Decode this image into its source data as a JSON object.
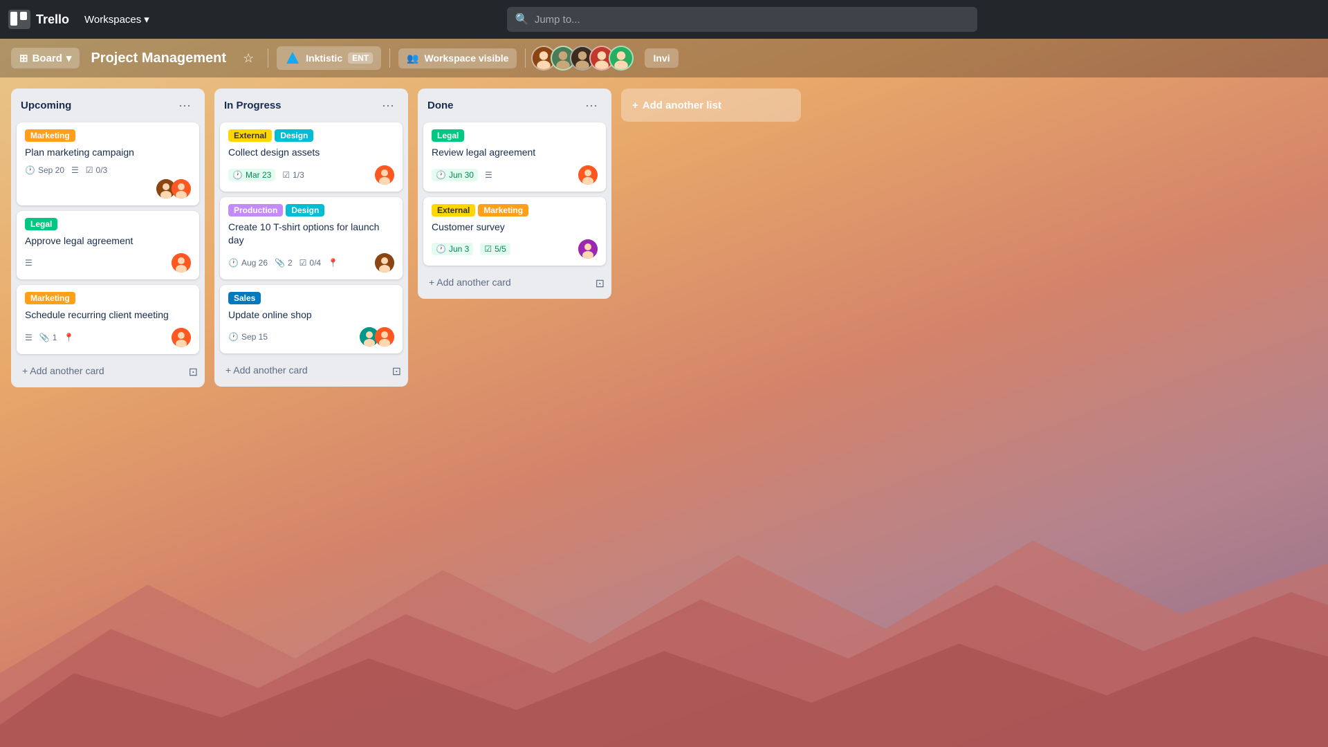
{
  "topNav": {
    "brand": "Trello",
    "workspacesLabel": "Workspaces",
    "searchPlaceholder": "Jump to..."
  },
  "boardHeader": {
    "boardLabel": "Board",
    "title": "Project Management",
    "inktisticLabel": "Inktistic",
    "entLabel": "ENT",
    "workspaceVisibleLabel": "Workspace visible",
    "inviteLabel": "Invi"
  },
  "lists": [
    {
      "id": "upcoming",
      "title": "Upcoming",
      "cards": [
        {
          "id": "c1",
          "labels": [
            {
              "text": "Marketing",
              "cls": "label-marketing"
            }
          ],
          "title": "Plan marketing campaign",
          "date": "Sep 20",
          "hasDesc": true,
          "checklist": "0/3",
          "avatars": [
            "av-brown",
            "av-orange"
          ]
        },
        {
          "id": "c2",
          "labels": [
            {
              "text": "Legal",
              "cls": "label-legal"
            }
          ],
          "title": "Approve legal agreement",
          "hasDesc": true,
          "avatars": [
            "av-orange"
          ]
        },
        {
          "id": "c3",
          "labels": [
            {
              "text": "Marketing",
              "cls": "label-marketing"
            }
          ],
          "title": "Schedule recurring client meeting",
          "hasDesc": true,
          "attachments": "1",
          "hasLocation": true,
          "avatars": [
            "av-orange"
          ]
        }
      ],
      "addLabel": "+ Add another card"
    },
    {
      "id": "inprogress",
      "title": "In Progress",
      "cards": [
        {
          "id": "c4",
          "labels": [
            {
              "text": "External",
              "cls": "label-external"
            },
            {
              "text": "Design",
              "cls": "label-design"
            }
          ],
          "title": "Collect design assets",
          "date": "Mar 23",
          "dateGreen": true,
          "checklist": "1/3",
          "avatars": [
            "av-orange"
          ]
        },
        {
          "id": "c5",
          "labels": [
            {
              "text": "Production",
              "cls": "label-production"
            },
            {
              "text": "Design",
              "cls": "label-design"
            }
          ],
          "title": "Create 10 T-shirt options for launch day",
          "date": "Aug 26",
          "attachments": "2",
          "checklist": "0/4",
          "hasLocation": true,
          "avatars": [
            "av-brown"
          ]
        },
        {
          "id": "c6",
          "labels": [
            {
              "text": "Sales",
              "cls": "label-sales"
            }
          ],
          "title": "Update online shop",
          "date": "Sep 15",
          "avatars": [
            "av-teal",
            "av-orange"
          ]
        }
      ],
      "addLabel": "+ Add another card"
    },
    {
      "id": "done",
      "title": "Done",
      "cards": [
        {
          "id": "c7",
          "labels": [
            {
              "text": "Legal",
              "cls": "label-legal"
            }
          ],
          "title": "Review legal agreement",
          "date": "Jun 30",
          "dateGreen": true,
          "hasDesc": true,
          "avatars": [
            "av-orange"
          ]
        },
        {
          "id": "c8",
          "labels": [
            {
              "text": "External",
              "cls": "label-external"
            },
            {
              "text": "Marketing",
              "cls": "label-marketing"
            }
          ],
          "title": "Customer survey",
          "date": "Jun 3",
          "dateGreen": true,
          "checklistGreen": "5/5",
          "avatars": [
            "av-purple"
          ]
        }
      ],
      "addLabel": "+ Add another card"
    }
  ]
}
